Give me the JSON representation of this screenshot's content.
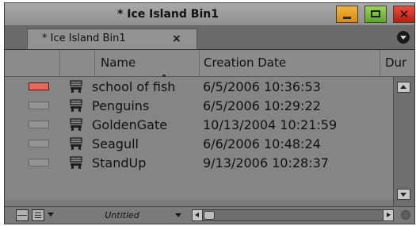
{
  "window": {
    "title": "* Ice Island Bin1",
    "close_glyph": "✕",
    "colors": {
      "minimize": "#e3a02a",
      "maximize": "#7dbd44",
      "close": "#d93628"
    }
  },
  "tab": {
    "label": "* Ice Island Bin1",
    "close_label": "×"
  },
  "fast_menu_icon": "fast-menu-icon",
  "columns": [
    "",
    "",
    "Name",
    "Creation Date",
    "Dur"
  ],
  "rows": [
    {
      "color": "red",
      "icon": "clip-icon",
      "name": "school of fish",
      "creation_date": "6/5/2006 10:36:53"
    },
    {
      "color": "none",
      "icon": "clip-icon",
      "name": "Penguins",
      "creation_date": "6/5/2006 10:29:22"
    },
    {
      "color": "none",
      "icon": "clip-icon",
      "name": "GoldenGate",
      "creation_date": "10/13/2004 10:21:59"
    },
    {
      "color": "none",
      "icon": "clip-icon",
      "name": "Seagull",
      "creation_date": "6/6/2006 10:48:24"
    },
    {
      "color": "none",
      "icon": "clip-icon",
      "name": "StandUp",
      "creation_date": "9/13/2006 10:28:37"
    }
  ],
  "bottom_bar": {
    "view_name": "Untitled",
    "icons": [
      "frame-view-icon",
      "text-view-icon",
      "view-menu-caret-icon"
    ]
  }
}
